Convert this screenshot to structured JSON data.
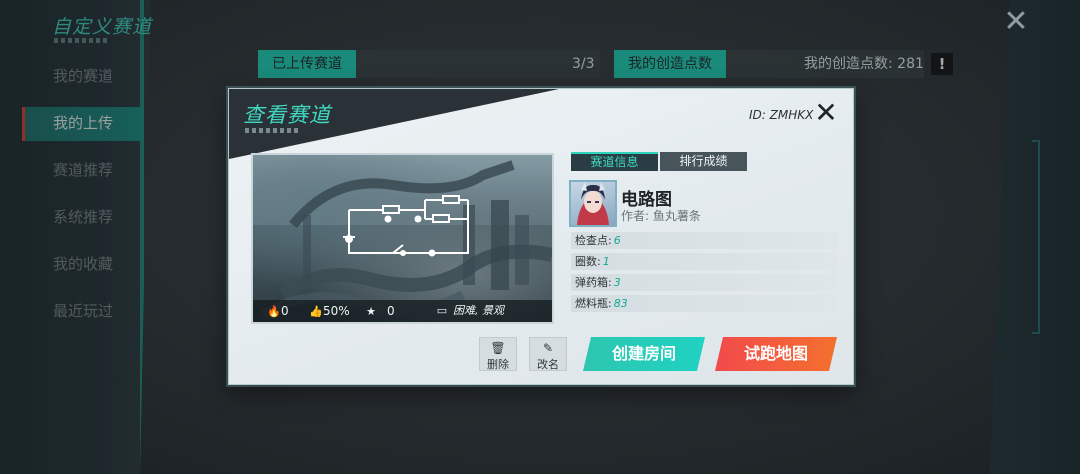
{
  "background": {
    "title": "自定义赛道",
    "nav_items": [
      {
        "label": "我的赛道",
        "active": false
      },
      {
        "label": "我的上传",
        "active": true
      },
      {
        "label": "赛道推荐",
        "active": false
      },
      {
        "label": "系统推荐",
        "active": false
      },
      {
        "label": "我的收藏",
        "active": false
      },
      {
        "label": "最近玩过",
        "active": false
      }
    ],
    "uploaded_label": "已上传赛道",
    "uploaded_count": "3/3",
    "creation_label": "我的创造点数",
    "creation_points_text": "我的创造点数: 281",
    "alert_symbol": "!",
    "close_symbol": "✕"
  },
  "modal": {
    "title": "查看赛道",
    "id_text": "ID: ZMHKX",
    "close_symbol": "✕",
    "preview": {
      "plays": "0",
      "like_rate": "50%",
      "stars": "0",
      "tags": "困难, 景观"
    },
    "tabs": [
      {
        "label": "赛道信息",
        "active": true
      },
      {
        "label": "排行成绩",
        "active": false
      }
    ],
    "map_name": "电路图",
    "author": "作者: 鱼丸薯条",
    "stats": [
      {
        "label": "检查点:",
        "value": "6"
      },
      {
        "label": "圈数:",
        "value": "1"
      },
      {
        "label": "弹药箱:",
        "value": "3"
      },
      {
        "label": "燃料瓶:",
        "value": "83"
      }
    ],
    "buttons": {
      "delete": "删除",
      "rename": "改名",
      "create_room": "创建房间",
      "test_run": "试跑地图"
    }
  },
  "colors": {
    "accent_teal": "#1ec7ad",
    "danger_red": "#f24a4c",
    "modal_bg": "#e6edf0"
  }
}
